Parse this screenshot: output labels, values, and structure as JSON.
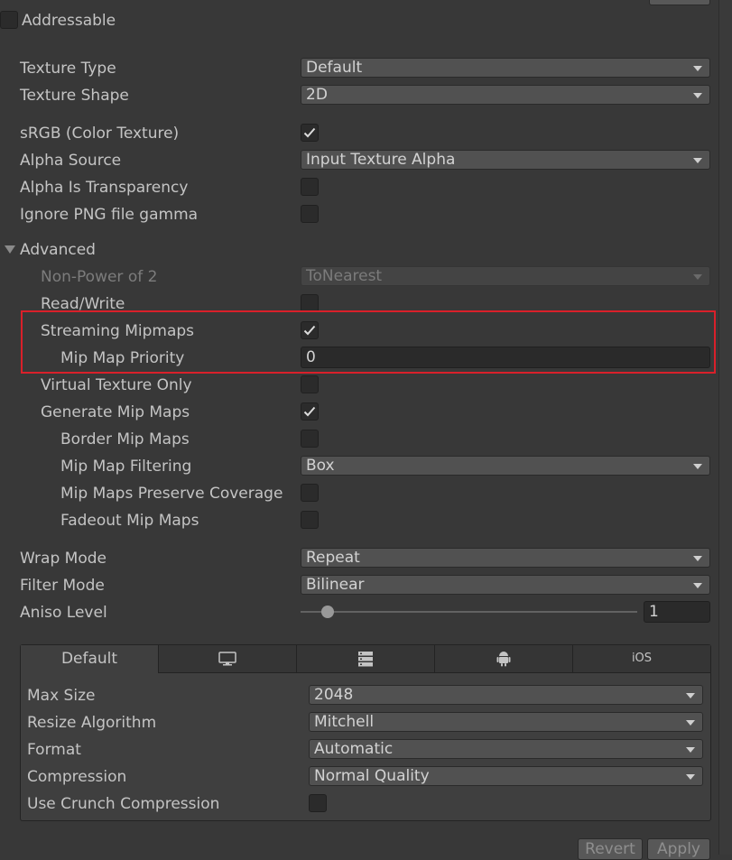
{
  "addressable": {
    "label": "Addressable",
    "checked": false
  },
  "texture_type": {
    "label": "Texture Type",
    "value": "Default"
  },
  "texture_shape": {
    "label": "Texture Shape",
    "value": "2D"
  },
  "srgb": {
    "label": "sRGB (Color Texture)",
    "checked": true
  },
  "alpha_source": {
    "label": "Alpha Source",
    "value": "Input Texture Alpha"
  },
  "alpha_is_transparency": {
    "label": "Alpha Is Transparency",
    "checked": false
  },
  "ignore_png_gamma": {
    "label": "Ignore PNG file gamma",
    "checked": false
  },
  "advanced": {
    "label": "Advanced",
    "expanded": true,
    "non_power_of_2": {
      "label": "Non-Power of 2",
      "value": "ToNearest",
      "disabled": true
    },
    "read_write": {
      "label": "Read/Write",
      "checked": false
    },
    "streaming_mipmaps": {
      "label": "Streaming Mipmaps",
      "checked": true
    },
    "mip_map_priority": {
      "label": "Mip Map Priority",
      "value": "0"
    },
    "virtual_texture_only": {
      "label": "Virtual Texture Only",
      "checked": false
    },
    "generate_mip_maps": {
      "label": "Generate Mip Maps",
      "checked": true
    },
    "border_mip_maps": {
      "label": "Border Mip Maps",
      "checked": false
    },
    "mip_map_filtering": {
      "label": "Mip Map Filtering",
      "value": "Box"
    },
    "mip_maps_preserve_coverage": {
      "label": "Mip Maps Preserve Coverage",
      "checked": false
    },
    "fadeout_mip_maps": {
      "label": "Fadeout Mip Maps",
      "checked": false
    }
  },
  "wrap_mode": {
    "label": "Wrap Mode",
    "value": "Repeat"
  },
  "filter_mode": {
    "label": "Filter Mode",
    "value": "Bilinear"
  },
  "aniso_level": {
    "label": "Aniso Level",
    "value": "1",
    "slider_fraction": 0.0
  },
  "platform_tabs": [
    {
      "label": "Default",
      "icon": null,
      "active": true
    },
    {
      "label": "",
      "icon": "monitor-icon",
      "active": false
    },
    {
      "label": "",
      "icon": "server-icon",
      "active": false
    },
    {
      "label": "",
      "icon": "android-icon",
      "active": false
    },
    {
      "label": "iOS",
      "icon": null,
      "active": false
    }
  ],
  "platform": {
    "max_size": {
      "label": "Max Size",
      "value": "2048"
    },
    "resize_algorithm": {
      "label": "Resize Algorithm",
      "value": "Mitchell"
    },
    "format": {
      "label": "Format",
      "value": "Automatic"
    },
    "compression": {
      "label": "Compression",
      "value": "Normal Quality"
    },
    "use_crunch": {
      "label": "Use Crunch Compression",
      "checked": false
    }
  },
  "buttons": {
    "revert": "Revert",
    "apply": "Apply"
  },
  "colors": {
    "highlight_border": "#d9202a",
    "background": "#383838"
  }
}
